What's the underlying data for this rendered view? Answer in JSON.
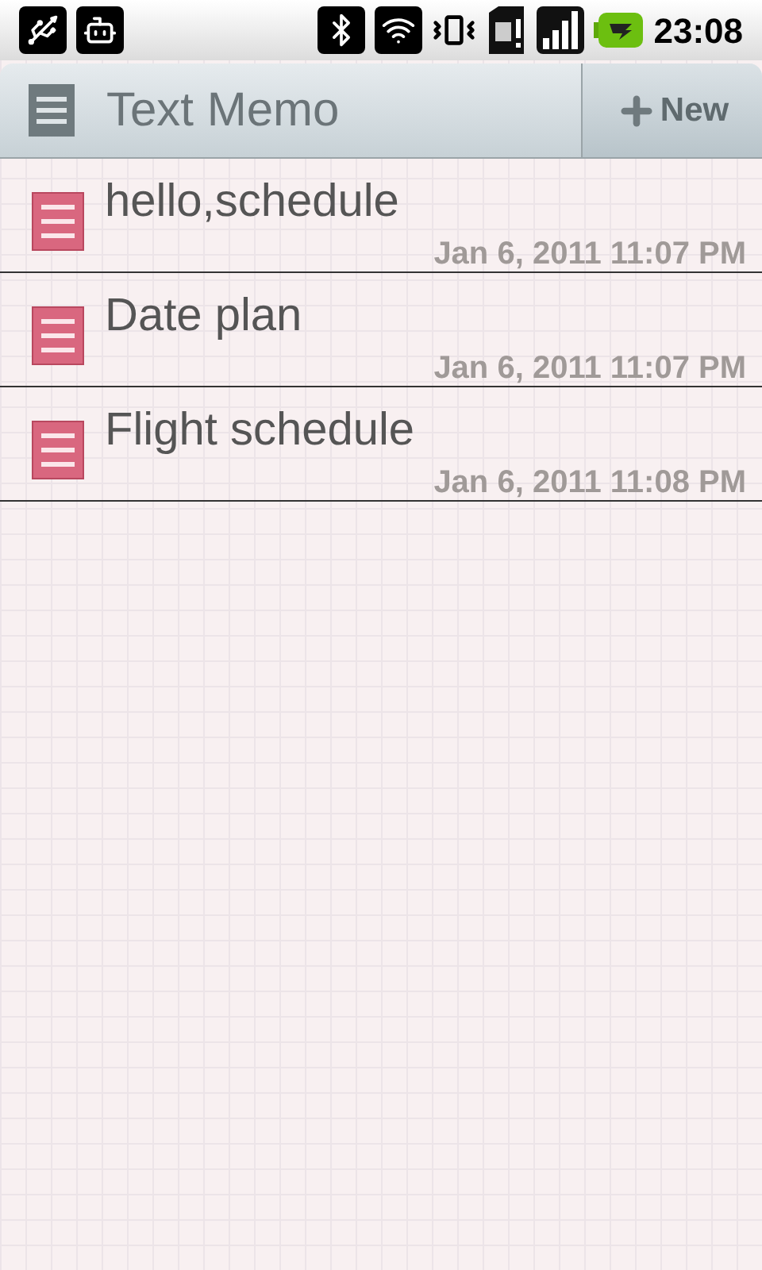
{
  "status_bar": {
    "time": "23:08"
  },
  "header": {
    "title": "Text Memo",
    "new_button": "New"
  },
  "memos": [
    {
      "title": "hello,schedule",
      "date": "Jan 6, 2011 11:07 PM"
    },
    {
      "title": "Date plan",
      "date": "Jan 6, 2011 11:07 PM"
    },
    {
      "title": "Flight schedule",
      "date": "Jan 6, 2011 11:08 PM"
    }
  ]
}
